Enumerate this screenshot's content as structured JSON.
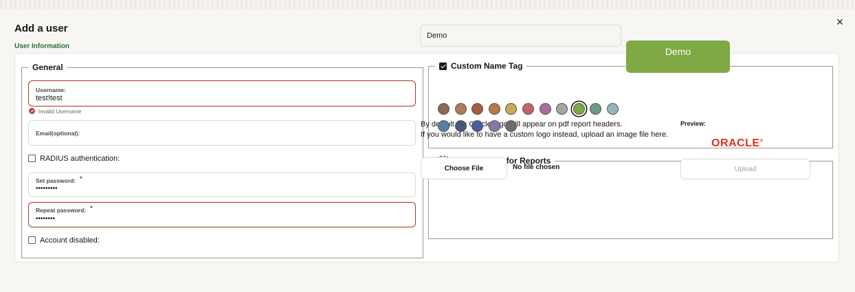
{
  "dialog": {
    "title": "Add a user",
    "close_icon": "×",
    "section_link": "User Information"
  },
  "general": {
    "legend": "General",
    "username": {
      "label": "Username:",
      "value": "test!test",
      "error": "Invalid Username"
    },
    "email": {
      "label": "Email(optional):",
      "value": ""
    },
    "radius": {
      "label": "RADIUS authentication:",
      "checked": false
    },
    "set_password": {
      "label": "Set password:",
      "required_mark": "*",
      "value": "•••••••••"
    },
    "repeat_password": {
      "label": "Repeat password:",
      "required_mark": "*",
      "value": "••••••••"
    },
    "account_disabled": {
      "label": "Account disabled:",
      "checked": false
    }
  },
  "name_tag": {
    "legend": "Custom Name Tag",
    "checked": true,
    "input_value": "Demo",
    "preview_text": "Demo",
    "preview_color": "#7ea944",
    "colors": [
      "#8a6a55",
      "#b07a5e",
      "#a85a44",
      "#b57a45",
      "#c6ac57",
      "#c2636a",
      "#a86f9a",
      "#a4a4a4",
      "#7ea944",
      "#6a9c82",
      "#92b8b9",
      "#5b7ea8",
      "#48587a",
      "#4d5ca4",
      "#8a76ac",
      "#6c6c6a"
    ],
    "selected_color_index": 8
  },
  "custom_logo": {
    "legend": "Custom Logo for Reports",
    "checked": true,
    "description_line1": "By default the Oracle logo will appear on pdf report headers.",
    "description_line2": "If you would like to have a custom logo instead, upload an image file here.",
    "preview_label": "Preview:",
    "logo_text": "ORACLE",
    "logo_mark": "®",
    "choose_file_label": "Choose File",
    "no_file_text": "No file chosen",
    "upload_label": "Upload"
  }
}
